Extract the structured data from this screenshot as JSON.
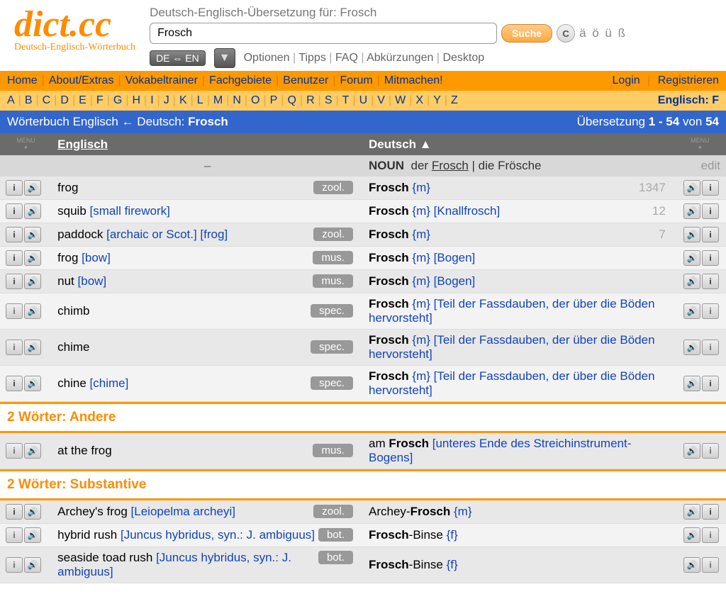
{
  "logo": "dict.cc",
  "logotag": "Deutsch-Englisch-Wörterbuch",
  "searchcap": "Deutsch-Englisch-Übersetzung für: Frosch",
  "query": "Frosch",
  "btn_search": "Suche",
  "btn_c": "C",
  "umlauts": "ä ö ü ß",
  "langsel": "DE ⇔ EN",
  "opts": [
    "Optionen",
    "Tipps",
    "FAQ",
    "Abkürzungen",
    "Desktop"
  ],
  "nav": [
    "Home",
    "About/Extras",
    "Vokabeltrainer",
    "Fachgebiete",
    "Benutzer",
    "Forum",
    "Mitmachen!"
  ],
  "login": "Login",
  "register": "Registrieren",
  "alpha": [
    "A",
    "B",
    "C",
    "D",
    "E",
    "F",
    "G",
    "H",
    "I",
    "J",
    "K",
    "L",
    "M",
    "N",
    "O",
    "P",
    "Q",
    "R",
    "S",
    "T",
    "U",
    "V",
    "W",
    "X",
    "Y",
    "Z"
  ],
  "alpha_right": "Englisch: F",
  "blue_left_a": "Wörterbuch Englisch",
  "blue_left_b": " ← Deutsch: ",
  "blue_left_c": "Frosch",
  "blue_right_a": "Übersetzung ",
  "blue_right_b": "1 - 54",
  "blue_right_c": " von ",
  "blue_right_d": "54",
  "th_en": "Englisch",
  "th_de": "Deutsch",
  "noun_lbl": "NOUN",
  "noun_sg_art": "der",
  "noun_sg": "Frosch",
  "noun_pl": "die Frösche",
  "edit": "edit",
  "dash": "–",
  "rows": [
    {
      "en": "frog",
      "ennote": "",
      "tag": "zool.",
      "de": "Frosch",
      "g": "{m}",
      "denote": "",
      "num": "1347",
      "act": true
    },
    {
      "en": "squib",
      "ennote": "[small firework]",
      "tag": "",
      "de": "Frosch",
      "g": "{m}",
      "denote": "[Knallfrosch]",
      "num": "12",
      "act": true
    },
    {
      "en": "paddock",
      "ennote": "[archaic or Scot.] [frog]",
      "tag": "zool.",
      "de": "Frosch",
      "g": "{m}",
      "denote": "",
      "num": "7",
      "act": true
    },
    {
      "en": "frog",
      "ennote": "[bow]",
      "tag": "mus.",
      "de": "Frosch",
      "g": "{m}",
      "denote": "[Bogen]",
      "num": "",
      "act": true
    },
    {
      "en": "nut",
      "ennote": "[bow]",
      "tag": "mus.",
      "de": "Frosch",
      "g": "{m}",
      "denote": "[Bogen]",
      "num": "",
      "act": true
    },
    {
      "en": "chimb",
      "ennote": "",
      "tag": "spec.",
      "de": "Frosch",
      "g": "{m}",
      "denote": "[Teil der Fassdauben, der über die Böden hervorsteht]",
      "num": "",
      "act": false
    },
    {
      "en": "chime",
      "ennote": "",
      "tag": "spec.",
      "de": "Frosch",
      "g": "{m}",
      "denote": "[Teil der Fassdauben, der über die Böden hervorsteht]",
      "num": "",
      "act": false
    },
    {
      "en": "chine",
      "ennote": "[chime]",
      "tag": "spec.",
      "de": "Frosch",
      "g": "{m}",
      "denote": "[Teil der Fassdauben, der über die Böden hervorsteht]",
      "num": "",
      "act": true
    }
  ],
  "sec1": "2 Wörter: Andere",
  "rows2": [
    {
      "en": "at the frog",
      "ennote": "",
      "tag": "mus.",
      "depre": "am ",
      "de": "Frosch",
      "g": "",
      "denote": "[unteres Ende des Streichinstrument-Bogens]",
      "act": false
    }
  ],
  "sec2": "2 Wörter: Substantive",
  "rows3": [
    {
      "en": "Archey's frog",
      "ennote": "[Leiopelma archeyi]",
      "tag": "zool.",
      "depre": "Archey-",
      "de": "Frosch",
      "g": "{m}",
      "denote": "",
      "act": true
    },
    {
      "en": "hybrid rush",
      "ennote": "[Juncus hybridus, syn.: J. ambiguus]",
      "tag": "bot.",
      "depre": "",
      "de": "Frosch",
      "depost": "-Binse",
      "g": "{f}",
      "denote": "",
      "act": false
    },
    {
      "en": "seaside toad rush",
      "ennote": "[Juncus hybridus, syn.: J. ambiguus]",
      "tag": "bot.",
      "depre": "",
      "de": "Frosch",
      "depost": "-Binse",
      "g": "{f}",
      "denote": "",
      "act": false
    }
  ]
}
